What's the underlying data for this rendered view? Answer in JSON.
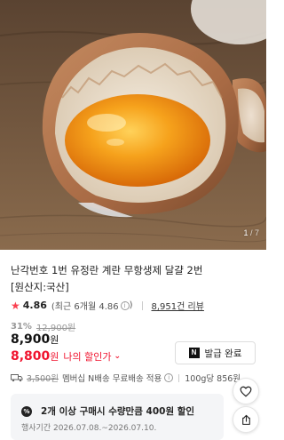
{
  "image": {
    "description_icon": "egg-yolk-photo",
    "counter_current": "1",
    "counter_total": " / 7"
  },
  "product": {
    "title_line1": "난각번호 1번 유정란 계란 무항생제 달걀 2번",
    "title_line2": "[원산지:국산]"
  },
  "rating": {
    "score": "4.86",
    "recent": "(최근 6개월 4.86",
    "recent_close": ")",
    "reviews": "8,951건 리뷰"
  },
  "pricing": {
    "discount_rate": "31%",
    "original_price": "12,900원",
    "price": "8,900",
    "price_unit": "원",
    "my_price": "8,800",
    "my_price_unit": "원",
    "my_price_label": "나의 할인가"
  },
  "coupon": {
    "badge": "N",
    "label": "발급 완료"
  },
  "shipping": {
    "original_fee": "3,500원",
    "info": "멤버십 N배송 무료배송 적용",
    "unit_price": "100g당 856원"
  },
  "promo": {
    "icon": "%",
    "title": "2개 이상 구매시 수량만큼 400원 할인",
    "period": "행사기간 2026.07.08.~2026.07.10."
  },
  "colors": {
    "accent_red": "#f0142f",
    "star": "#fa4050",
    "promo_bg": "#f4f5f7"
  }
}
